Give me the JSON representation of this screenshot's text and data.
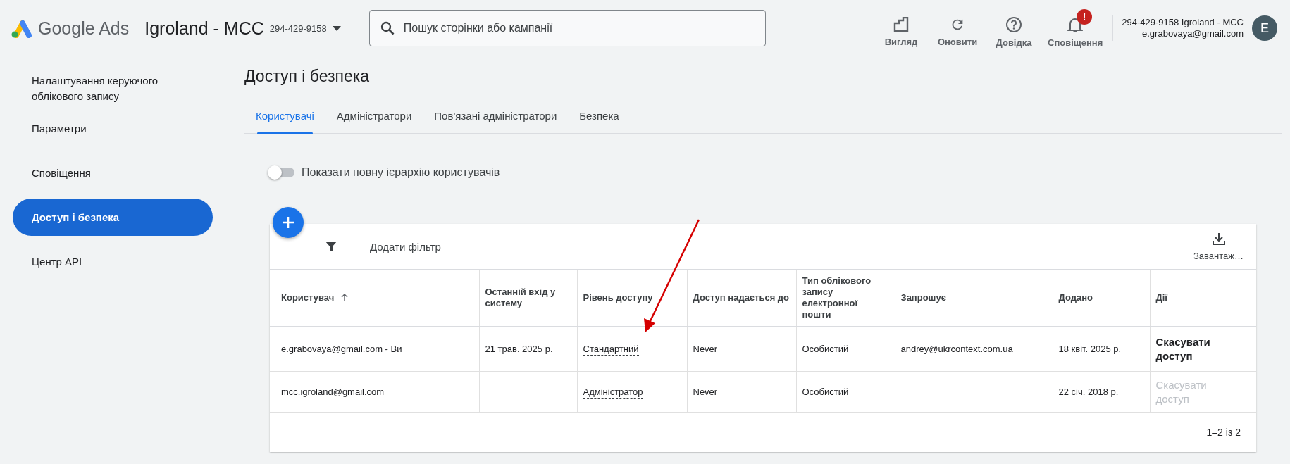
{
  "header": {
    "product": "Google Ads",
    "account_name": "Igroland - MCC",
    "account_id": "294-429-9158",
    "search": {
      "placeholder": "Пошук сторінки або кампанії"
    },
    "actions": [
      {
        "kind": "view",
        "label": "Вигляд"
      },
      {
        "kind": "refresh",
        "label": "Оновити"
      },
      {
        "kind": "help",
        "label": "Довідка"
      },
      {
        "kind": "notifications",
        "label": "Сповіщення",
        "badge": "!"
      }
    ],
    "user": {
      "account": "294-429-9158 Igroland - MCC",
      "email": "e.grabovaya@gmail.com",
      "avatar": "E"
    }
  },
  "sidebar": {
    "items": [
      {
        "label": "Налаштування керуючого облікового запису",
        "selected": false
      },
      {
        "label": "Параметри",
        "selected": false
      },
      {
        "label": "Сповіщення",
        "selected": false
      },
      {
        "label": "Доступ і безпека",
        "selected": true
      },
      {
        "label": "Центр API",
        "selected": false
      }
    ]
  },
  "page": {
    "title": "Доступ і безпека",
    "tabs": [
      {
        "label": "Користувачі",
        "selected": true
      },
      {
        "label": "Адміністратори",
        "selected": false
      },
      {
        "label": "Пов'язані адміністратори",
        "selected": false
      },
      {
        "label": "Безпека",
        "selected": false
      }
    ],
    "toggle": {
      "label": "Показати повну ієрархію користувачів",
      "on": false
    }
  },
  "table": {
    "filter": "Додати фільтр",
    "download": "Завантаж…",
    "columns": [
      {
        "label": "Користувач",
        "sorted": true
      },
      {
        "label": "Останній вхід у систему"
      },
      {
        "label": "Рівень доступу"
      },
      {
        "label": "Доступ надається до"
      },
      {
        "label": "Тип облікового запису електронної пошти"
      },
      {
        "label": "Запрошує"
      },
      {
        "label": "Додано"
      },
      {
        "label": "Дії"
      }
    ],
    "rows": [
      {
        "user": "e.grabovaya@gmail.com - Ви",
        "last_login": "21 трав. 2025 р.",
        "access_level": "Стандартний",
        "access_until": "Never",
        "account_type": "Особистий",
        "inviter": "andrey@ukrcontext.com.ua",
        "added": "18 квіт. 2025 р.",
        "action": {
          "label": "Скасувати доступ",
          "disabled": false
        }
      },
      {
        "user": "mcc.igroland@gmail.com",
        "access_level": "Адміністратор",
        "access_until": "Never",
        "account_type": "Особистий",
        "added": "22 січ. 2018 р.",
        "action": {
          "label": "Скасувати доступ",
          "disabled": true
        }
      }
    ],
    "pagination": "1–2 із 2"
  }
}
